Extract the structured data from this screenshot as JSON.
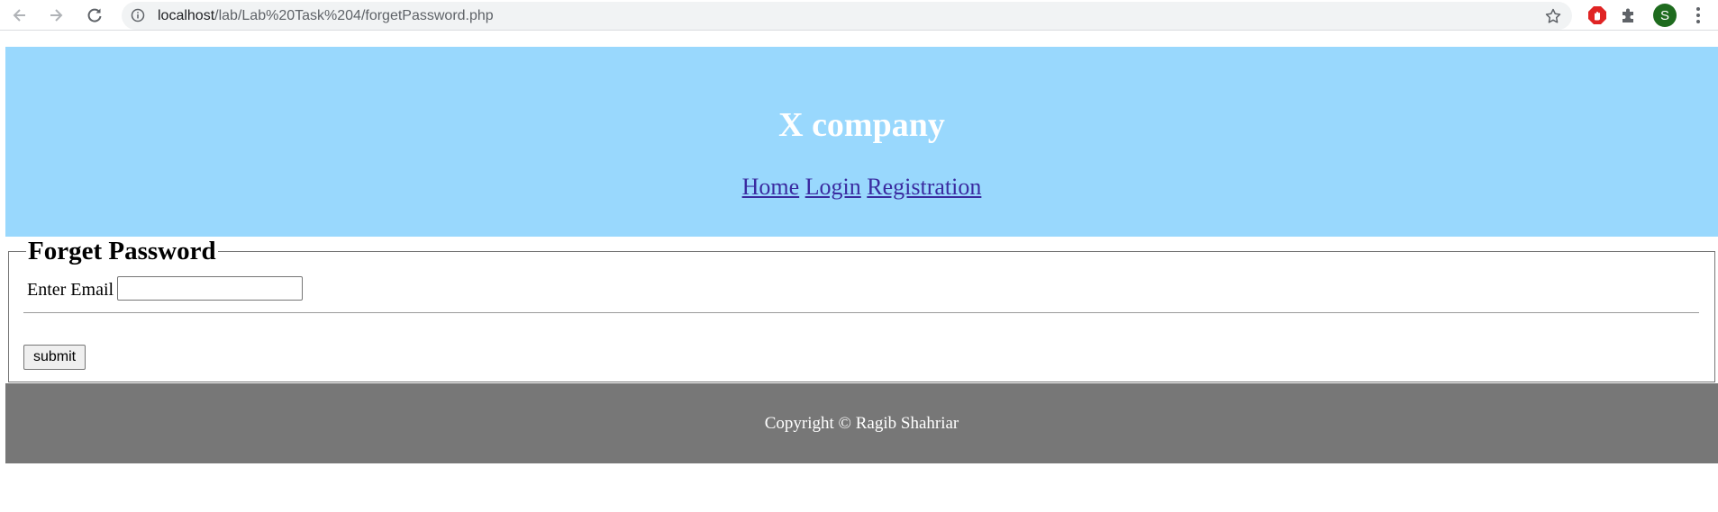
{
  "browser": {
    "url_host": "localhost",
    "url_path": "/lab/Lab%20Task%204/forgetPassword.php",
    "profile_initial": "S",
    "back_icon": "arrow-left-icon",
    "forward_icon": "arrow-right-icon",
    "reload_icon": "reload-icon",
    "info_icon": "info-icon",
    "bookmark_icon": "star-icon",
    "extension_icons": [
      "adblock-icon",
      "puzzle-icon"
    ],
    "menu_icon": "kebab-menu-icon"
  },
  "header": {
    "title": "X company",
    "nav": {
      "home": "Home",
      "login": "Login",
      "registration": "Registration"
    },
    "background_color": "#99d8fd",
    "link_color": "#3a2ba0"
  },
  "form": {
    "legend": "Forget Password",
    "email_label": "Enter Email",
    "email_value": "",
    "submit_label": "submit"
  },
  "footer": {
    "copyright": "Copyright © Ragib Shahriar",
    "background_color": "#777777"
  }
}
